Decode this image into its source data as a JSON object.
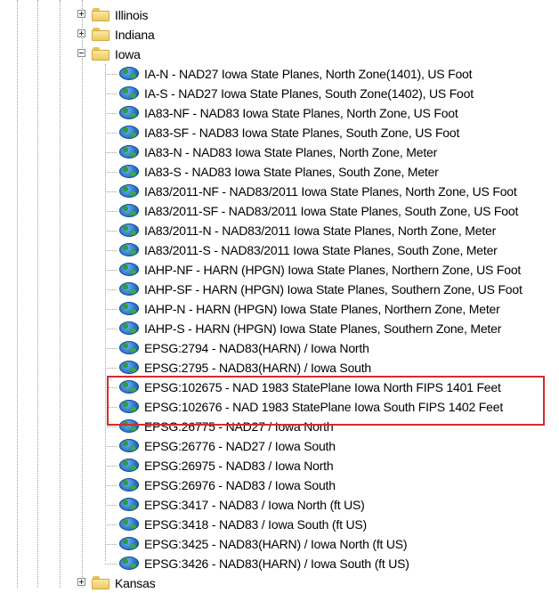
{
  "tree": {
    "top_folders": [
      {
        "label": "Illinois",
        "expanded": false
      },
      {
        "label": "Indiana",
        "expanded": false
      },
      {
        "label": "Iowa",
        "expanded": true
      }
    ],
    "iowa_items": [
      "IA-N - NAD27 Iowa State Planes, North Zone(1401), US Foot",
      "IA-S - NAD27 Iowa State Planes, South Zone(1402), US Foot",
      "IA83-NF - NAD83 Iowa State Planes, North Zone, US Foot",
      "IA83-SF - NAD83 Iowa State Planes, South Zone, US Foot",
      "IA83-N - NAD83 Iowa State Planes, North Zone, Meter",
      "IA83-S - NAD83 Iowa State Planes, South Zone, Meter",
      "IA83/2011-NF - NAD83/2011 Iowa State Planes, North Zone, US Foot",
      "IA83/2011-SF - NAD83/2011 Iowa State Planes, South Zone, US Foot",
      "IA83/2011-N - NAD83/2011 Iowa State Planes, North Zone, Meter",
      "IA83/2011-S - NAD83/2011 Iowa State Planes, South Zone, Meter",
      "IAHP-NF - HARN (HPGN) Iowa State Planes, Northern Zone, US Foot",
      "IAHP-SF - HARN (HPGN) Iowa State Planes, Southern Zone, US Foot",
      "IAHP-N - HARN (HPGN) Iowa State Planes, Northern Zone, Meter",
      "IAHP-S - HARN (HPGN) Iowa State Planes, Southern Zone, Meter",
      "EPSG:2794 - NAD83(HARN) / Iowa North",
      "EPSG:2795 - NAD83(HARN) / Iowa South",
      "EPSG:102675 - NAD 1983 StatePlane Iowa North FIPS 1401 Feet",
      "EPSG:102676 - NAD 1983 StatePlane Iowa South FIPS 1402 Feet",
      "EPSG:26775 - NAD27 / Iowa North",
      "EPSG:26776 - NAD27 / Iowa South",
      "EPSG:26975 - NAD83 / Iowa North",
      "EPSG:26976 - NAD83 / Iowa South",
      "EPSG:3417 - NAD83 / Iowa North (ft US)",
      "EPSG:3418 - NAD83 / Iowa South (ft US)",
      "EPSG:3425 - NAD83(HARN) / Iowa North (ft US)",
      "EPSG:3426 - NAD83(HARN) / Iowa South (ft US)"
    ],
    "bottom_folder": {
      "label": "Kansas",
      "expanded": false
    },
    "highlighted_items": [
      16,
      17
    ]
  },
  "colors": {
    "highlight_border": "#d62b2b",
    "globe": "#2a72c8",
    "folder": "#eccb62"
  },
  "icons": {
    "folder": "folder-icon",
    "leaf": "globe-icon",
    "expand": "plus-icon",
    "collapse": "minus-icon"
  }
}
